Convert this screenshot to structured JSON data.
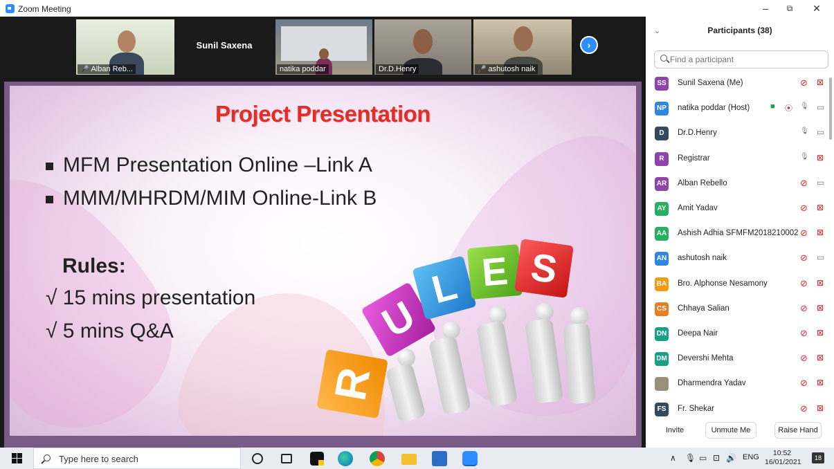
{
  "window": {
    "title": "Zoom Meeting",
    "minimize": "–",
    "restore": "⧉",
    "close": "✕"
  },
  "video_strip": {
    "tiles": [
      {
        "label": "Alban Reb..."
      },
      {
        "name": "Sunil Saxena"
      },
      {
        "label": "natika poddar"
      },
      {
        "label": "Dr.D.Henry"
      },
      {
        "label": "ashutosh naik"
      }
    ],
    "next_icon": "chevron-right-icon"
  },
  "slide": {
    "title": "Project Presentation",
    "bullets": [
      "MFM Presentation Online –Link A",
      "MMM/MHRDM/MIM  Online-Link B"
    ],
    "rules_heading": "Rules:",
    "rules": [
      "√  15 mins presentation",
      "√  5 mins Q&A"
    ],
    "cube_letters": [
      "R",
      "U",
      "L",
      "E",
      "S"
    ]
  },
  "participants": {
    "title": "Participants (38)",
    "search_placeholder": "Find a participant",
    "list": [
      {
        "initials": "SS",
        "name": "Sunil Saxena (Me)",
        "color": "#8e44ad",
        "mic": "muted",
        "cam": "off"
      },
      {
        "initials": "NP",
        "name": "natika poddar (Host)",
        "color": "#2e86de",
        "mic": "on",
        "cam": "on"
      },
      {
        "initials": "D",
        "name": "Dr.D.Henry",
        "color": "#34495e",
        "mic": "on",
        "cam": "on"
      },
      {
        "initials": "R",
        "name": "Registrar",
        "color": "#8e44ad",
        "mic": "on",
        "cam": "off"
      },
      {
        "initials": "AR",
        "name": "Alban Rebello",
        "color": "#8e44ad",
        "mic": "muted",
        "cam": "on"
      },
      {
        "initials": "AY",
        "name": "Amit Yadav",
        "color": "#27ae60",
        "mic": "muted",
        "cam": "off"
      },
      {
        "initials": "AA",
        "name": "Ashish Adhia SFMFM2018210002",
        "color": "#27ae60",
        "mic": "muted",
        "cam": "off"
      },
      {
        "initials": "AN",
        "name": "ashutosh naik",
        "color": "#2e86de",
        "mic": "muted",
        "cam": "on"
      },
      {
        "initials": "BA",
        "name": "Bro. Alphonse Nesamony",
        "color": "#f39c12",
        "mic": "muted",
        "cam": "off"
      },
      {
        "initials": "CS",
        "name": "Chhaya Salian",
        "color": "#e67e22",
        "mic": "muted",
        "cam": "off"
      },
      {
        "initials": "DN",
        "name": "Deepa Nair",
        "color": "#16a085",
        "mic": "muted",
        "cam": "off"
      },
      {
        "initials": "DM",
        "name": "Devershi Mehta",
        "color": "#16a085",
        "mic": "muted",
        "cam": "off"
      },
      {
        "initials": "",
        "name": "Dharmendra Yadav",
        "color": "#9a8f7a",
        "mic": "muted",
        "cam": "off"
      },
      {
        "initials": "FS",
        "name": "Fr. Shekar",
        "color": "#34495e",
        "mic": "muted",
        "cam": "off"
      }
    ],
    "footer": {
      "invite": "Invite",
      "unmute": "Unmute Me",
      "raise_hand": "Raise Hand"
    }
  },
  "taskbar": {
    "search_placeholder": "Type here to search",
    "language": "ENG",
    "time": "10:52",
    "date": "16/01/2021",
    "notifications": "18"
  }
}
